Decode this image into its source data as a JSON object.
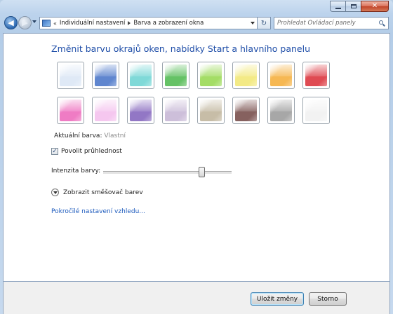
{
  "window": {
    "close_glyph": "✕"
  },
  "nav": {
    "back_glyph": "◀",
    "forward_glyph": "▶",
    "breadcrumb_prefix": "«",
    "breadcrumb": [
      "Individuální nastavení",
      "Barva a zobrazení okna"
    ],
    "refresh_glyph": "↻",
    "search_placeholder": "Prohledat Ovládací panely"
  },
  "page": {
    "title": "Změnit barvu okrajů oken, nabídky Start a hlavního panelu",
    "current_color_label": "Aktuální barva:",
    "current_color_value": "Vlastní",
    "transparency_label": "Povolit průhlednost",
    "transparency_checked": true,
    "check_glyph": "✓",
    "intensity_label": "Intenzita barvy:",
    "intensity_value": 0.78,
    "mixer_label": "Zobrazit směšovač barev",
    "advanced_link": "Pokročilé nastavení vzhledu..."
  },
  "swatches": [
    {
      "name": "sky",
      "color": "#dfe9f6"
    },
    {
      "name": "twilight",
      "color": "#5f86cf"
    },
    {
      "name": "sea",
      "color": "#7fd9d8"
    },
    {
      "name": "leaf",
      "color": "#65c266"
    },
    {
      "name": "lime",
      "color": "#a4dd66"
    },
    {
      "name": "lemon",
      "color": "#f3ea86"
    },
    {
      "name": "pumpkin",
      "color": "#f6b853"
    },
    {
      "name": "ruby",
      "color": "#df4b53"
    },
    {
      "name": "fuchsia",
      "color": "#ef7cc4"
    },
    {
      "name": "blush",
      "color": "#f5c7ef"
    },
    {
      "name": "violet",
      "color": "#9277c5"
    },
    {
      "name": "lavender",
      "color": "#cdbfda"
    },
    {
      "name": "taupe",
      "color": "#c7bda7"
    },
    {
      "name": "chocolate",
      "color": "#86615f"
    },
    {
      "name": "slate",
      "color": "#a7a7a7"
    },
    {
      "name": "frost",
      "color": "#f2f2f2"
    }
  ],
  "footer": {
    "save_label": "Uložit změny",
    "cancel_label": "Storno"
  }
}
